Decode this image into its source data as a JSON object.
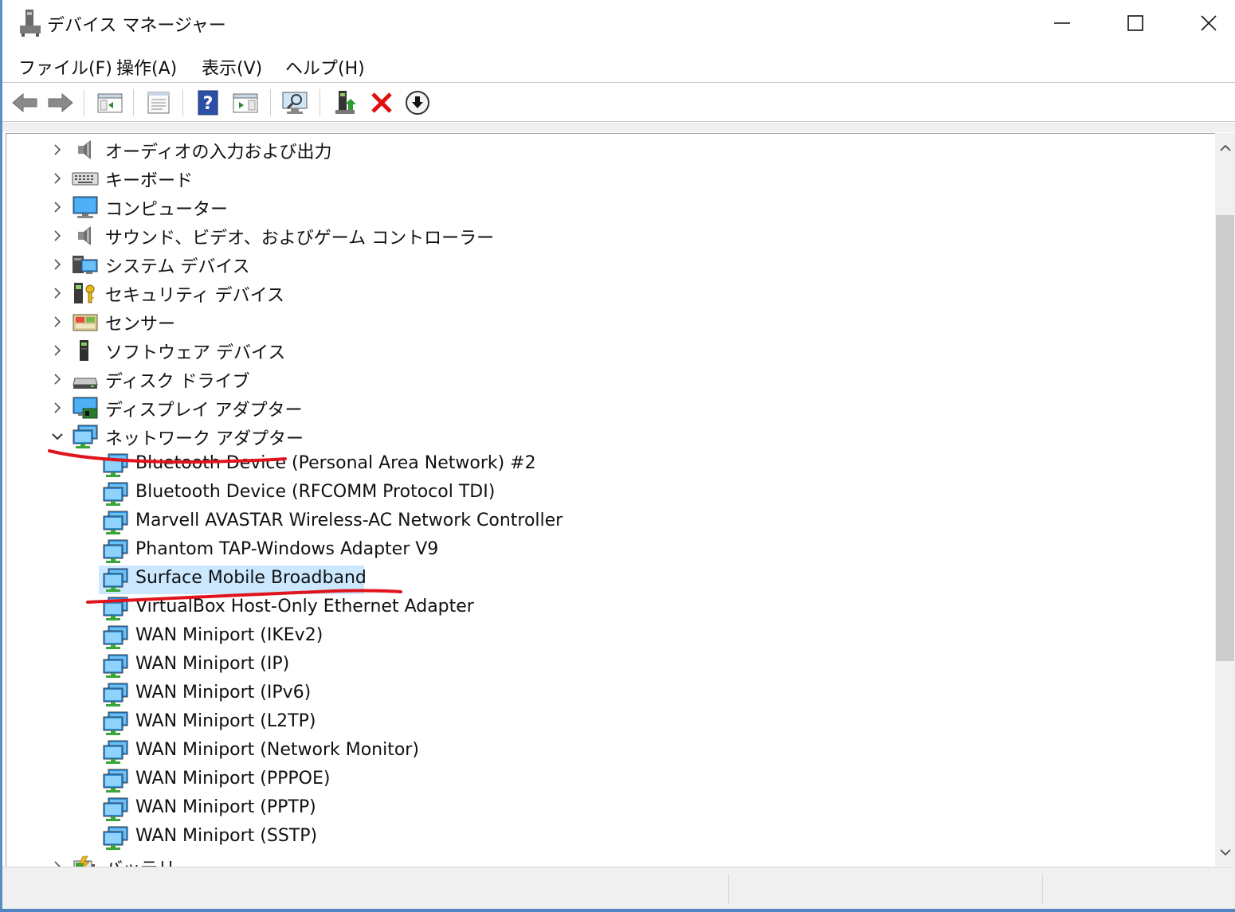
{
  "window": {
    "title": "デバイス マネージャー"
  },
  "menu": [
    "ファイル(F)",
    "操作(A)",
    "表示(V)",
    "ヘルプ(H)"
  ],
  "toolbar": {
    "buttons": [
      "back",
      "forward",
      "show-hide-console-tree",
      "properties",
      "help",
      "action-pane",
      "scan-hardware-changes",
      "update-driver",
      "uninstall-device",
      "disable-device"
    ]
  },
  "tree": {
    "categories": [
      {
        "label": "オーディオの入力および出力",
        "icon": "speaker-icon",
        "expanded": false
      },
      {
        "label": "キーボード",
        "icon": "keyboard-icon",
        "expanded": false
      },
      {
        "label": "コンピューター",
        "icon": "computer-icon",
        "expanded": false
      },
      {
        "label": "サウンド、ビデオ、およびゲーム コントローラー",
        "icon": "speaker-icon",
        "expanded": false
      },
      {
        "label": "システム デバイス",
        "icon": "system-devices-icon",
        "expanded": false
      },
      {
        "label": "セキュリティ デバイス",
        "icon": "security-device-icon",
        "expanded": false
      },
      {
        "label": "センサー",
        "icon": "sensor-icon",
        "expanded": false
      },
      {
        "label": "ソフトウェア デバイス",
        "icon": "software-device-icon",
        "expanded": false
      },
      {
        "label": "ディスク ドライブ",
        "icon": "disk-drive-icon",
        "expanded": false
      },
      {
        "label": "ディスプレイ アダプター",
        "icon": "display-adapter-icon",
        "expanded": false
      },
      {
        "label": "ネットワーク アダプター",
        "icon": "network-adapter-icon",
        "expanded": true
      }
    ],
    "network_adapters": [
      "Bluetooth Device (Personal Area Network) #2",
      "Bluetooth Device (RFCOMM Protocol TDI)",
      "Marvell AVASTAR Wireless-AC Network Controller",
      "Phantom TAP-Windows Adapter V9",
      "Surface Mobile Broadband",
      "VirtualBox Host-Only Ethernet Adapter",
      "WAN Miniport (IKEv2)",
      "WAN Miniport (IP)",
      "WAN Miniport (IPv6)",
      "WAN Miniport (L2TP)",
      "WAN Miniport (Network Monitor)",
      "WAN Miniport (PPPOE)",
      "WAN Miniport (PPTP)",
      "WAN Miniport (SSTP)"
    ],
    "selected": "Surface Mobile Broadband",
    "partial_next": {
      "label": "バッテリ",
      "icon": "battery-icon"
    }
  },
  "colors": {
    "selection": "#cce8ff",
    "annotation": "#e0141c",
    "window_border": "#5a8fc4"
  }
}
